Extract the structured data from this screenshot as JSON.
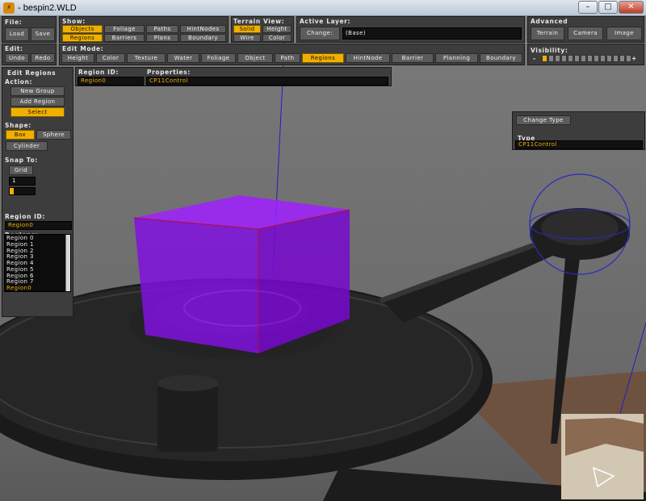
{
  "window": {
    "title": "- bespin2.WLD",
    "app_icon": "app-logo-icon",
    "minimize": "–",
    "maximize": "□",
    "close": "✕"
  },
  "toolbar": {
    "file_label": "File:",
    "load": "Load",
    "save": "Save",
    "show_label": "Show:",
    "show_buttons": [
      "Objects",
      "Foliage",
      "Paths",
      "HintNodes",
      "Regions",
      "Barriers",
      "Plans",
      "Boundary"
    ],
    "terrain_view_label": "Terrain View:",
    "terrain_buttons": [
      "Solid",
      "Height",
      "Wire",
      "Color"
    ],
    "active_layer_label": "Active Layer:",
    "change": "Change:",
    "active_layer_value": "(Base)",
    "advanced_label": "Advanced",
    "terrain": "Terrain",
    "camera": "Camera",
    "image": "Image",
    "edit_label": "Edit:",
    "undo": "Undo",
    "redo": "Redo",
    "edit_mode_label": "Edit Mode:",
    "edit_modes": [
      "Height",
      "Color",
      "Texture",
      "Water",
      "Foliage",
      "Object",
      "Path",
      "Regions",
      "HintNode",
      "Barrier",
      "Planning",
      "Boundary"
    ],
    "visibility_label": "Visibility:",
    "vis_minus": "-",
    "vis_plus": "+",
    "visibility_level": 1,
    "visibility_max": 14
  },
  "regions_panel": {
    "title": "Edit Regions",
    "action_label": "Action:",
    "new_group": "New Group",
    "add_region": "Add Region",
    "select": "Select",
    "shape_label": "Shape:",
    "box": "Box",
    "sphere": "Sphere",
    "cylinder": "Cylinder",
    "snap_label": "Snap To:",
    "grid": "Grid",
    "snap_value": "1",
    "region_id_label": "Region ID:",
    "region_id_value": "Region0",
    "regions_label": "Regions:",
    "regions": [
      "Region 0",
      "Region 1",
      "Region 2",
      "Region 3",
      "Region 4",
      "Region 5",
      "Region 6",
      "Region 7",
      "Region0"
    ]
  },
  "info_bar": {
    "region_id_label": "Region ID:",
    "region_id_value": "Region0",
    "properties_label": "Properties:",
    "properties_value": "CP11Control"
  },
  "type_panel": {
    "change_type": "Change Type",
    "type_label": "Type",
    "type_value": "CP11Control"
  },
  "colors": {
    "accent": "#f0b000",
    "panel": "#3d3d3d",
    "region_box": "#9010f0"
  }
}
